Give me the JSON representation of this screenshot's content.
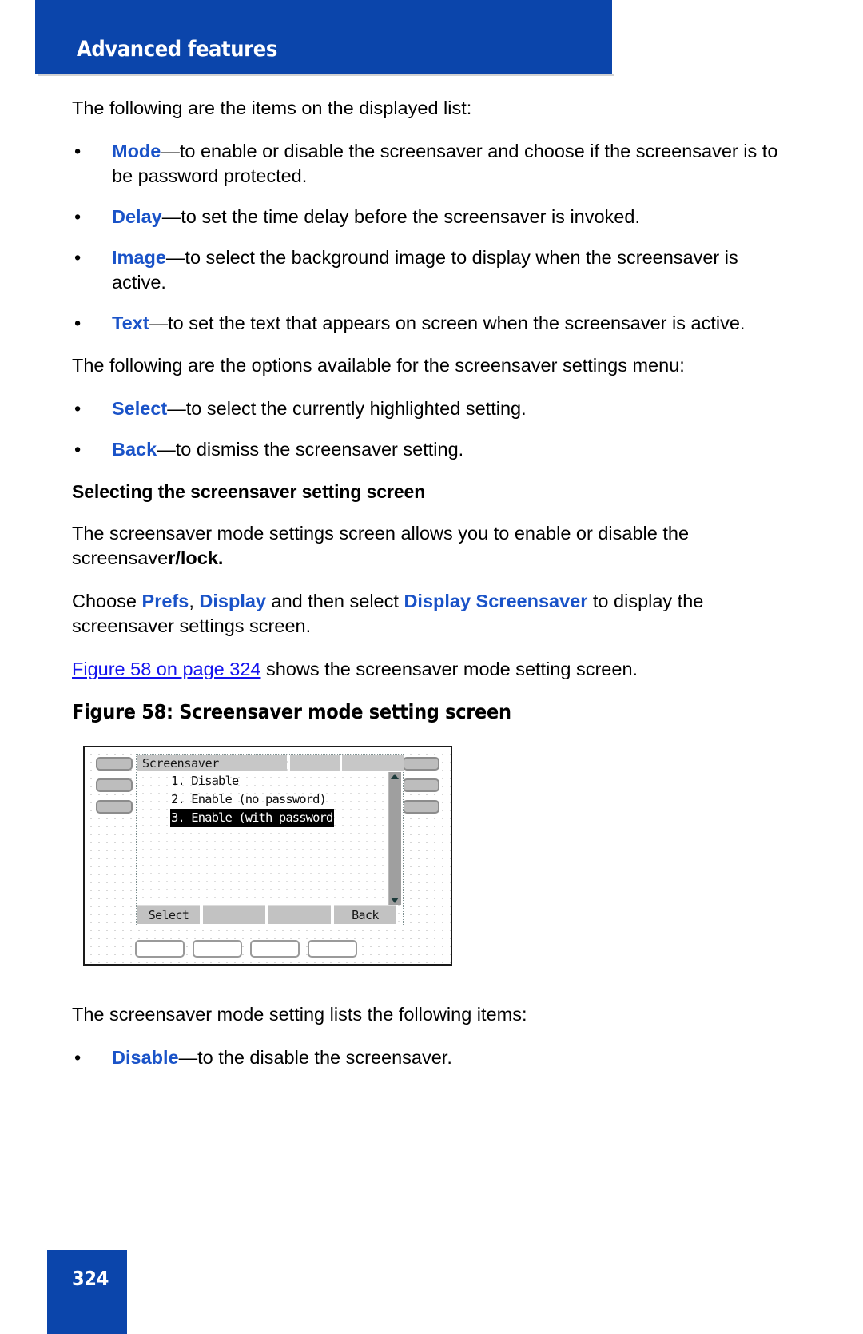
{
  "header": {
    "title": "Advanced features"
  },
  "content": {
    "intro_list": "The following are the items on the displayed list:",
    "items": [
      {
        "term": "Mode",
        "desc": "—to enable or disable the screensaver and choose if the screensaver is to be password protected."
      },
      {
        "term": "Delay",
        "desc": "—to set the time delay before the screensaver is invoked."
      },
      {
        "term": "Image",
        "desc": "—to select the background image to display when the screensaver is active."
      },
      {
        "term": "Text",
        "desc": "—to set the text that appears on screen when the screensaver is active."
      }
    ],
    "intro_options": "The following are the options available for the screensaver settings menu:",
    "options": [
      {
        "term": "Select",
        "desc": "—to select the currently highlighted setting."
      },
      {
        "term": "Back",
        "desc": "—to dismiss the screensaver setting."
      }
    ],
    "subheading": "Selecting the screensaver setting screen",
    "para_mode_a": "The screensaver mode settings screen allows you to enable or disable the screensave",
    "para_mode_b": "r/lock.",
    "choose": {
      "lead": "Choose ",
      "prefs": "Prefs",
      "comma": ", ",
      "display": "Display",
      "mid": " and then select ",
      "display_screensaver": "Display Screensaver",
      "tail": " to display the screensaver settings screen."
    },
    "figure_ref": {
      "link": "Figure 58 on page 324",
      "rest": " shows the screensaver mode setting screen."
    },
    "figure_caption": "Figure 58: Screensaver mode setting screen",
    "after_figure": "The screensaver mode setting lists the following items:",
    "mode_items": [
      {
        "term": "Disable",
        "desc": "—to the disable the screensaver."
      }
    ]
  },
  "figure": {
    "lcd_title": "Screensaver",
    "list": [
      "1. Disable",
      "2. Enable (no password)",
      "3. Enable (with password"
    ],
    "selected_index": 2,
    "softkeys": [
      "Select",
      "",
      "",
      "Back"
    ]
  },
  "footer": {
    "page_number": "324"
  },
  "colors": {
    "brand_blue": "#0b45ab",
    "keyword_blue": "#1a53c8",
    "link_blue": "#1414ee"
  }
}
